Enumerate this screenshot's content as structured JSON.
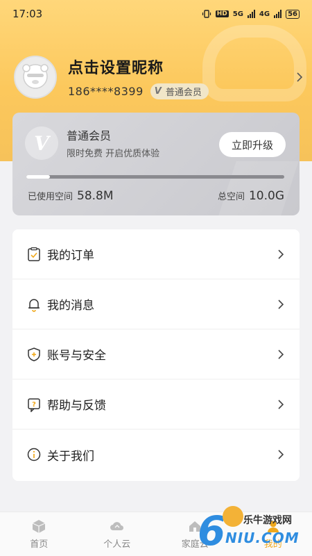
{
  "statusbar": {
    "time": "17:03",
    "hd": "HD",
    "net1": "5G",
    "net2": "4G",
    "battery": "56"
  },
  "profile": {
    "nickname": "点击设置昵称",
    "phone": "186****8399",
    "member_tag": "普通会员",
    "member_tag_icon": "V"
  },
  "member_card": {
    "badge": "V",
    "title": "普通会员",
    "subtitle": "限时免费 开启优质体验",
    "upgrade_label": "立即升级",
    "used_label": "已使用空间",
    "used_value": "58.8M",
    "total_label": "总空间",
    "total_value": "10.0G",
    "usage_fraction": 0.006
  },
  "menu": {
    "items": [
      {
        "label": "我的订单",
        "icon": "order-icon"
      },
      {
        "label": "我的消息",
        "icon": "bell-icon"
      },
      {
        "label": "账号与安全",
        "icon": "shield-icon"
      },
      {
        "label": "帮助与反馈",
        "icon": "help-icon"
      },
      {
        "label": "关于我们",
        "icon": "info-icon"
      }
    ]
  },
  "tabbar": {
    "tabs": [
      {
        "label": "首页",
        "icon": "home-icon"
      },
      {
        "label": "个人云",
        "icon": "cloud-icon"
      },
      {
        "label": "家庭云",
        "icon": "family-cloud-icon"
      },
      {
        "label": "我的",
        "icon": "user-icon"
      }
    ],
    "active": 3
  },
  "watermark": {
    "digit": "6",
    "name": "乐牛游戏网",
    "domain": "NIU.COM"
  },
  "colors": {
    "accent": "#f0a81c",
    "hero": "#fcc85c",
    "card": "#d2d2d6"
  }
}
